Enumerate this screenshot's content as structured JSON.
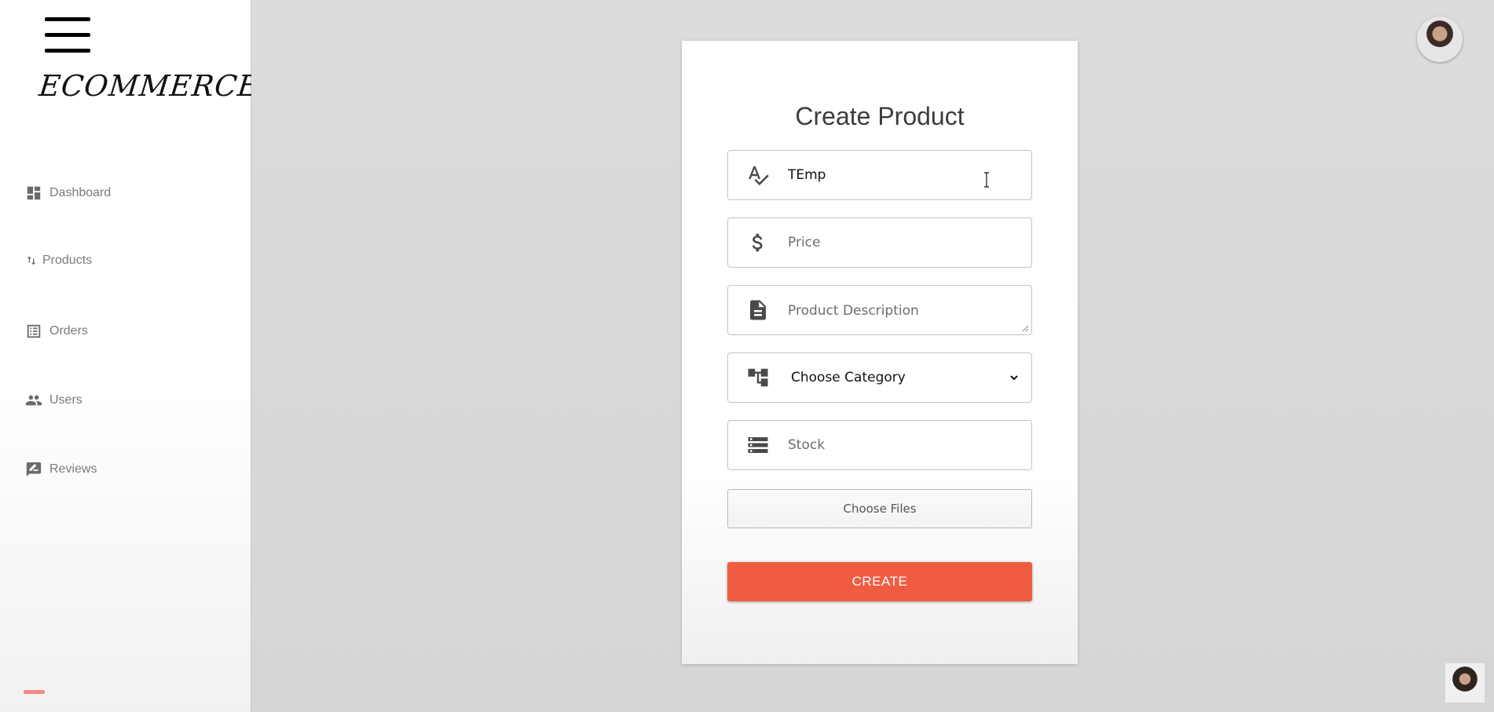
{
  "sidebar": {
    "logo": "ECOMMERCE.",
    "items": [
      {
        "label": "Dashboard",
        "icon": "dashboard-icon"
      },
      {
        "label": "Products",
        "icon": "sort-arrows-icon"
      },
      {
        "label": "Orders",
        "icon": "list-alt-icon"
      },
      {
        "label": "Users",
        "icon": "people-icon"
      },
      {
        "label": "Reviews",
        "icon": "rate-review-icon"
      }
    ]
  },
  "form": {
    "title": "Create Product",
    "name_value": "TEmp",
    "name_icon": "spellcheck-icon",
    "price_placeholder": "Price",
    "price_icon": "dollar-icon",
    "description_placeholder": "Product Description",
    "description_icon": "description-icon",
    "category_selected": "Choose Category",
    "category_icon": "account-tree-icon",
    "stock_placeholder": "Stock",
    "stock_icon": "storage-icon",
    "file_button_label": "Choose Files",
    "submit_label": "CREATE"
  },
  "colors": {
    "accent": "#f05c42",
    "background": "#d9d9d9",
    "card": "#ffffff"
  }
}
